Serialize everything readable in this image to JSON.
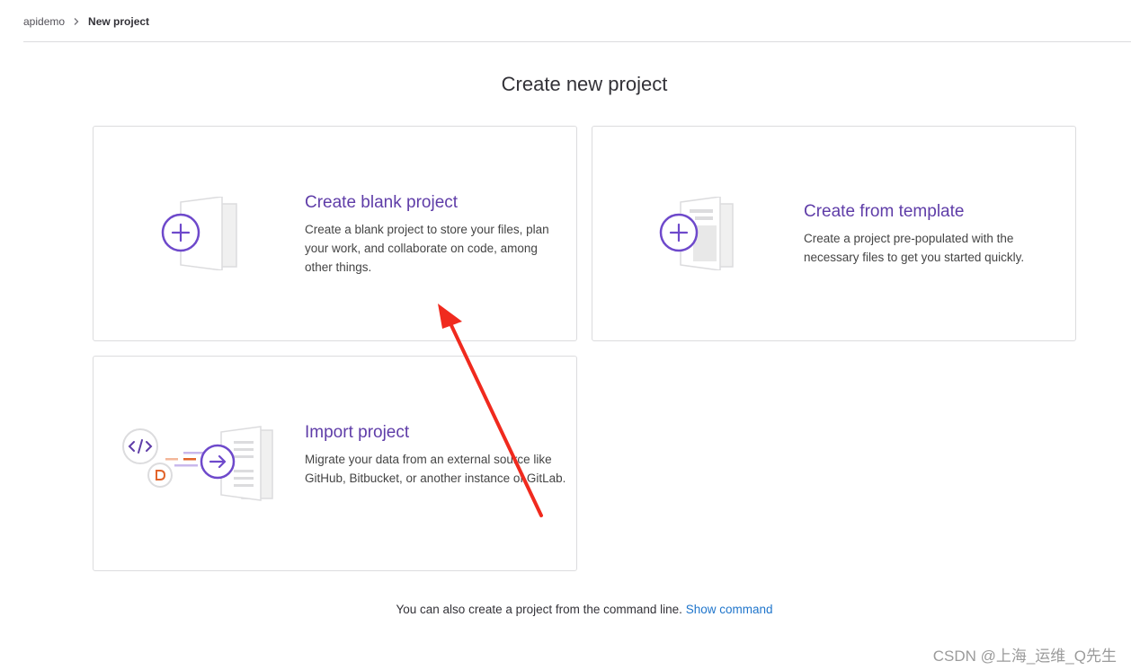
{
  "breadcrumb": {
    "root": "apidemo",
    "current": "New project"
  },
  "page_title": "Create new project",
  "cards": {
    "blank": {
      "title": "Create blank project",
      "description": "Create a blank project to store your files, plan your work, and collaborate on code, among other things."
    },
    "template": {
      "title": "Create from template",
      "description": "Create a project pre-populated with the necessary files to get you started quickly."
    },
    "import": {
      "title": "Import project",
      "description": "Migrate your data from an external source like GitHub, Bitbucket, or another instance of GitLab."
    }
  },
  "footer": {
    "text": "You can also create a project from the command line.",
    "link": "Show command"
  },
  "watermark": "CSDN @上海_运维_Q先生",
  "colors": {
    "accent_purple": "#5f3da8",
    "link_blue": "#1f75cb",
    "annotation_red": "#f02a1e",
    "orange": "#e2642b"
  },
  "icons": {
    "breadcrumb_separator": "chevron-right-icon",
    "blank_illustration": "plus-document-icon",
    "template_illustration": "plus-template-icon",
    "import_illustration": "import-arrow-icon"
  }
}
